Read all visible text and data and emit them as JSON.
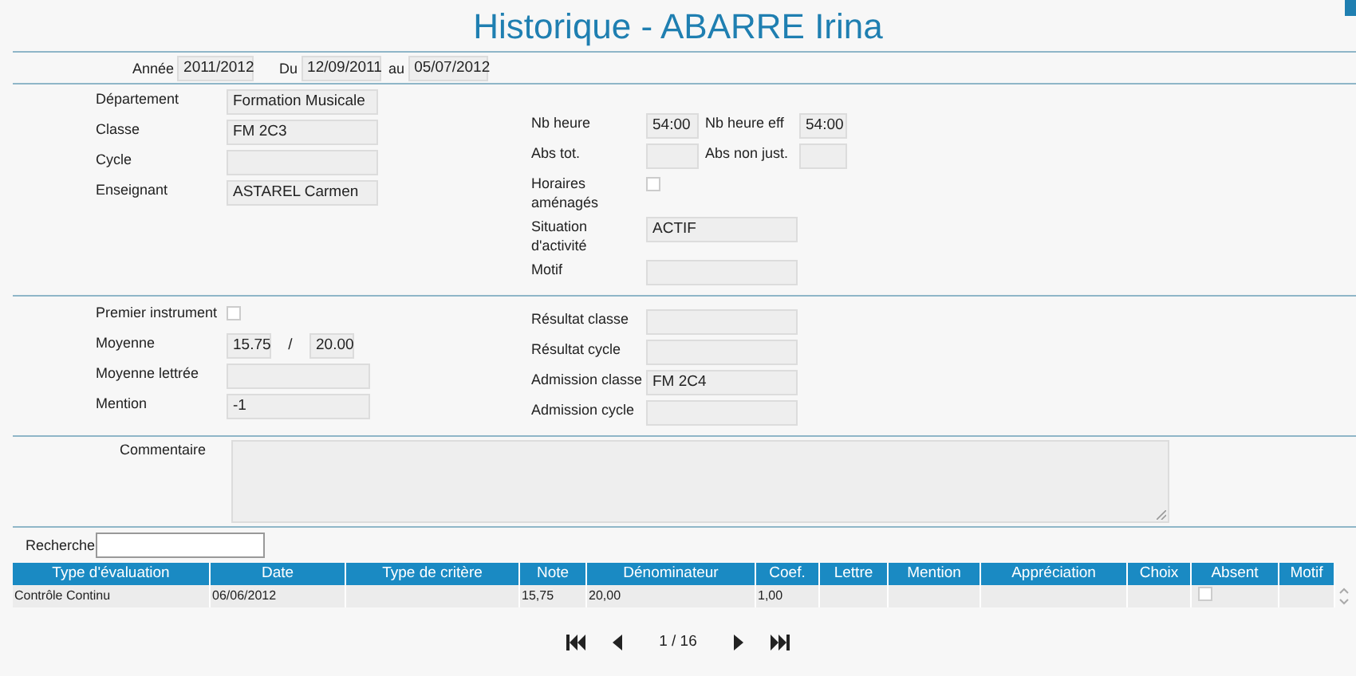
{
  "title": "Historique - ABARRE Irina",
  "period": [
    {
      "label": "Année",
      "value": "2011/2012"
    },
    {
      "label": "Du",
      "value": "12/09/2011"
    },
    {
      "label": "au",
      "value": "05/07/2012"
    }
  ],
  "enrolment": {
    "left": [
      {
        "kind": "field",
        "label": "Département",
        "value": "Formation Musicale"
      },
      {
        "kind": "field",
        "label": "Classe",
        "value": "FM 2C3"
      },
      {
        "kind": "field",
        "label": "Cycle"
      },
      {
        "kind": "field",
        "label": "Enseignant",
        "value": "ASTAREL Carmen"
      }
    ],
    "right": [
      {
        "kind": "pair",
        "label": "Nb heure",
        "value": "54:00",
        "label2": "Nb heure eff",
        "value2": "54:00"
      },
      {
        "kind": "pair",
        "label": "Abs tot.",
        "label2": "Abs non just."
      },
      {
        "kind": "checkbox",
        "label": "Horaires aménagés",
        "checked": false
      },
      {
        "kind": "field",
        "label": "Situation d'activité",
        "value": "ACTIF"
      },
      {
        "kind": "field",
        "label": "Motif"
      }
    ]
  },
  "results": {
    "left": [
      {
        "kind": "checkbox",
        "label": "Premier instrument",
        "checked": false
      },
      {
        "kind": "ratio",
        "label": "Moyenne",
        "value": "15.75",
        "separator": "/",
        "value2": "20.00"
      },
      {
        "kind": "field",
        "label": "Moyenne lettrée"
      },
      {
        "kind": "field",
        "label": "Mention",
        "value": "-1"
      }
    ],
    "right": [
      {
        "kind": "field",
        "label": "Résultat classe"
      },
      {
        "kind": "field",
        "label": "Résultat cycle"
      },
      {
        "kind": "field",
        "label": "Admission classe",
        "value": "FM 2C4"
      },
      {
        "kind": "field",
        "label": "Admission cycle"
      }
    ]
  },
  "comment": {
    "label": "Commentaire"
  },
  "search": {
    "label": "Recherche"
  },
  "table": {
    "columns": [
      "Type d'évaluation",
      "Date",
      "Type de critère",
      "Note",
      "Dénominateur",
      "Coef.",
      "Lettre",
      "Mention",
      "Appréciation",
      "Choix",
      "Absent",
      "Motif"
    ],
    "rows": [
      {
        "cells": [
          "Contrôle Continu",
          "06/06/2012",
          "",
          "15,75",
          "20,00",
          "1,00"
        ],
        "absent": false
      }
    ]
  },
  "pager": {
    "text": "1 / 16"
  }
}
